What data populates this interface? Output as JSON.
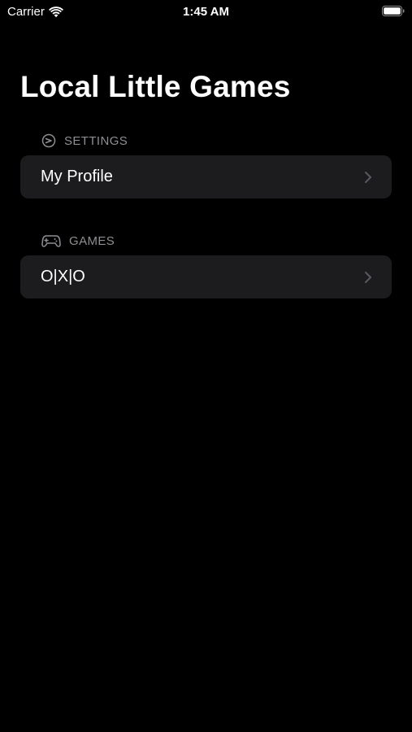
{
  "status_bar": {
    "carrier": "Carrier",
    "time": "1:45 AM",
    "icons": [
      "wifi-icon",
      "battery-icon"
    ]
  },
  "title": "Local Little Games",
  "sections": {
    "settings": {
      "header": "SETTINGS",
      "icon": "settings-gauge-icon",
      "rows": [
        {
          "label": "My Profile",
          "icon": "chevron-right-icon"
        }
      ]
    },
    "games": {
      "header": "GAMES",
      "icon": "game-controller-icon",
      "rows": [
        {
          "label": "O|X|O",
          "icon": "chevron-right-icon"
        }
      ]
    }
  },
  "colors": {
    "background": "#000000",
    "row_background": "#1c1c1e",
    "header_text": "#8e8e93",
    "chevron": "#5a5a5e",
    "text": "#ffffff"
  }
}
